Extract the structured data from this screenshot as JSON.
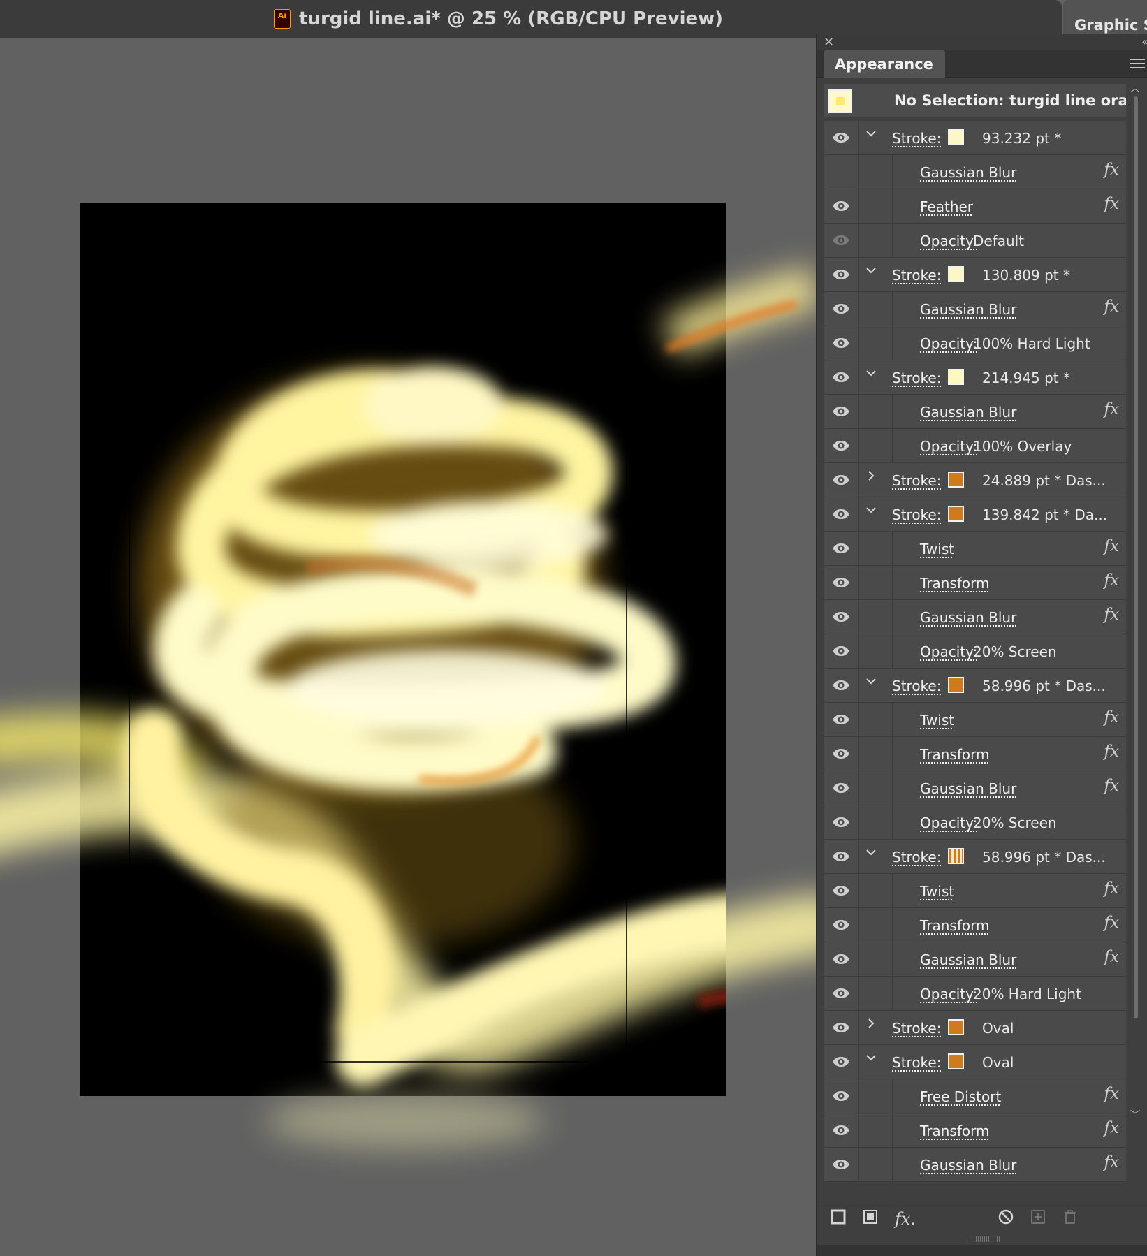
{
  "document": {
    "title": "turgid line.ai* @ 25 % (RGB/CPU Preview)",
    "file_badge": "Ai"
  },
  "right_tab": {
    "label": "Graphic St"
  },
  "panel": {
    "title": "Appearance",
    "selection": "No Selection: turgid line orange",
    "rows": [
      {
        "kind": "stroke",
        "label": "Stroke:",
        "twirl": "open",
        "swatch": "#fdf7c4",
        "value": "93.232 pt *",
        "eye": true
      },
      {
        "kind": "effect",
        "label": "Gaussian Blur",
        "fx": true,
        "eye": false
      },
      {
        "kind": "effect",
        "label": "Feather",
        "fx": true,
        "eye": true
      },
      {
        "kind": "opacity",
        "label": "Opacity:",
        "value": "Default",
        "eye": "dim"
      },
      {
        "kind": "stroke",
        "label": "Stroke:",
        "twirl": "open",
        "swatch": "#fdf7c4",
        "value": "130.809 pt *",
        "eye": true
      },
      {
        "kind": "effect",
        "label": "Gaussian Blur",
        "fx": true,
        "eye": true
      },
      {
        "kind": "opacity",
        "label": "Opacity:",
        "value": "100% Hard Light",
        "eye": true
      },
      {
        "kind": "stroke",
        "label": "Stroke:",
        "twirl": "open",
        "swatch": "#fdf7c4",
        "value": "214.945 pt *",
        "eye": true
      },
      {
        "kind": "effect",
        "label": "Gaussian Blur",
        "fx": true,
        "eye": true
      },
      {
        "kind": "opacity",
        "label": "Opacity:",
        "value": "100% Overlay",
        "eye": true
      },
      {
        "kind": "stroke",
        "label": "Stroke:",
        "twirl": "closed",
        "swatch": "#d07a1e",
        "value": "24.889 pt * Das...",
        "eye": true
      },
      {
        "kind": "stroke",
        "label": "Stroke:",
        "twirl": "open",
        "swatch": "#d07a1e",
        "value": "139.842 pt * Da...",
        "eye": true
      },
      {
        "kind": "effect",
        "label": "Twist",
        "fx": true,
        "eye": true
      },
      {
        "kind": "effect",
        "label": "Transform",
        "fx": true,
        "eye": true
      },
      {
        "kind": "effect",
        "label": "Gaussian Blur",
        "fx": true,
        "eye": true
      },
      {
        "kind": "opacity",
        "label": "Opacity:",
        "value": "20% Screen",
        "eye": true
      },
      {
        "kind": "stroke",
        "label": "Stroke:",
        "twirl": "open",
        "swatch": "#d07a1e",
        "value": "58.996 pt * Das...",
        "eye": true
      },
      {
        "kind": "effect",
        "label": "Twist",
        "fx": true,
        "eye": true
      },
      {
        "kind": "effect",
        "label": "Transform",
        "fx": true,
        "eye": true
      },
      {
        "kind": "effect",
        "label": "Gaussian Blur",
        "fx": true,
        "eye": true
      },
      {
        "kind": "opacity",
        "label": "Opacity:",
        "value": "20% Screen",
        "eye": true
      },
      {
        "kind": "stroke",
        "label": "Stroke:",
        "twirl": "open",
        "swatch": "pattern",
        "value": "58.996 pt * Das...",
        "eye": true
      },
      {
        "kind": "effect",
        "label": "Twist",
        "fx": true,
        "eye": true
      },
      {
        "kind": "effect",
        "label": "Transform",
        "fx": true,
        "eye": true
      },
      {
        "kind": "effect",
        "label": "Gaussian Blur",
        "fx": true,
        "eye": true
      },
      {
        "kind": "opacity",
        "label": "Opacity:",
        "value": "20% Hard Light",
        "eye": true
      },
      {
        "kind": "stroke",
        "label": "Stroke:",
        "twirl": "closed",
        "swatch": "#d07a1e",
        "value": "Oval",
        "eye": true
      },
      {
        "kind": "stroke",
        "label": "Stroke:",
        "twirl": "open",
        "swatch": "#d07a1e",
        "value": "Oval",
        "eye": true
      },
      {
        "kind": "effect",
        "label": "Free Distort",
        "fx": true,
        "eye": true
      },
      {
        "kind": "effect",
        "label": "Transform",
        "fx": true,
        "eye": true
      },
      {
        "kind": "effect",
        "label": "Gaussian Blur",
        "fx": true,
        "eye": true
      }
    ],
    "fx_symbol": "fx",
    "toolbar": {
      "add_stroke": "add-new-stroke",
      "add_fill": "add-new-fill",
      "add_effect": "fx.",
      "clear": "clear-appearance",
      "duplicate": "duplicate-item",
      "delete": "delete-item"
    }
  }
}
